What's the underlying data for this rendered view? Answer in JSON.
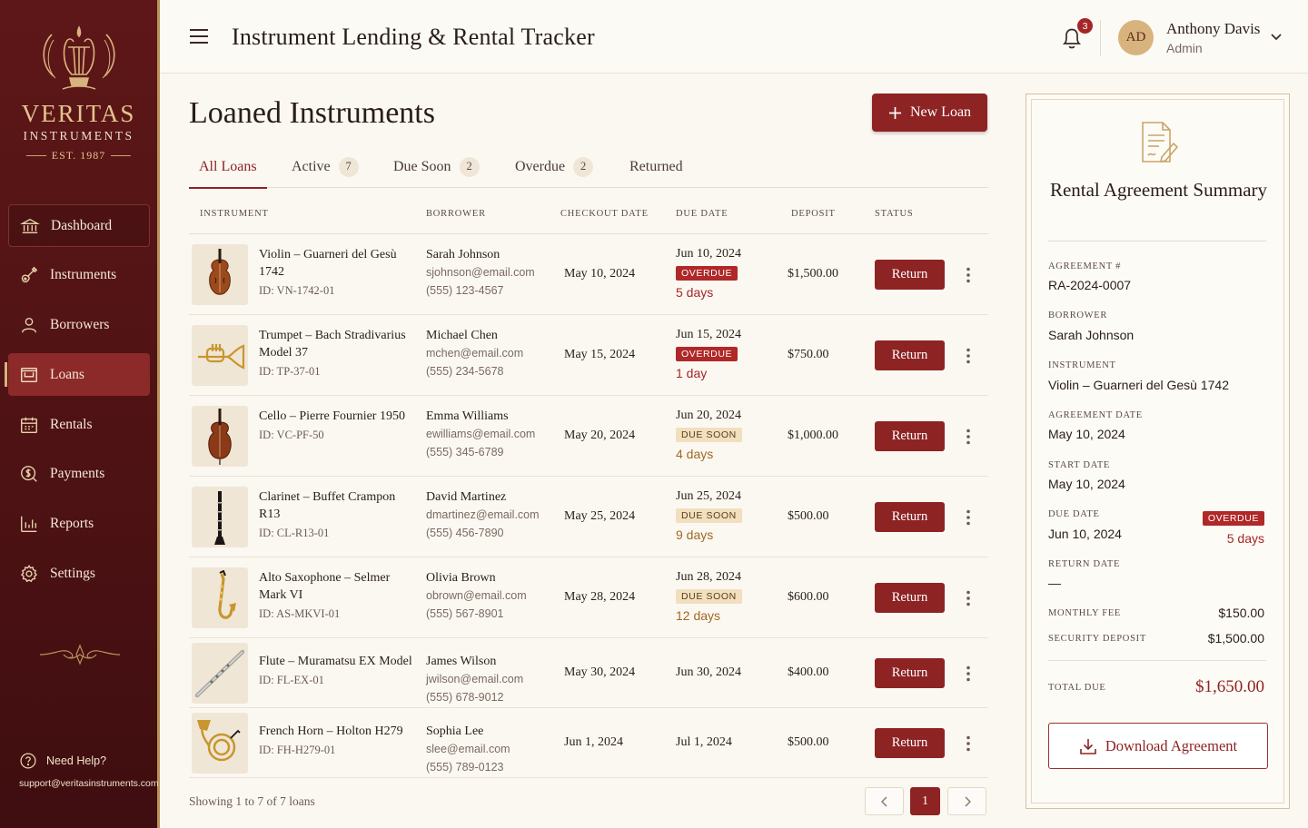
{
  "brand": {
    "name": "VERITAS",
    "sub": "INSTRUMENTS",
    "est": "EST. 1987"
  },
  "sidebar": {
    "items": [
      {
        "label": "Dashboard"
      },
      {
        "label": "Instruments"
      },
      {
        "label": "Borrowers"
      },
      {
        "label": "Loans"
      },
      {
        "label": "Rentals"
      },
      {
        "label": "Payments"
      },
      {
        "label": "Reports"
      },
      {
        "label": "Settings"
      }
    ],
    "active": "Loans",
    "help_label": "Need Help?",
    "help_email": "support@veritasinstruments.com"
  },
  "header": {
    "title": "Instrument Lending & Rental Tracker",
    "notification_count": "3",
    "user_initials": "AD",
    "user_name": "Anthony Davis",
    "user_role": "Admin"
  },
  "main": {
    "page_title": "Loaned Instruments",
    "new_loan_label": "New Loan",
    "tabs": [
      {
        "label": "All Loans",
        "count": ""
      },
      {
        "label": "Active",
        "count": "7"
      },
      {
        "label": "Due Soon",
        "count": "2"
      },
      {
        "label": "Overdue",
        "count": "2"
      },
      {
        "label": "Returned",
        "count": ""
      }
    ],
    "columns": [
      "INSTRUMENT",
      "BORROWER",
      "CHECKOUT DATE",
      "DUE DATE",
      "DEPOSIT",
      "STATUS"
    ],
    "return_label": "Return",
    "rows": [
      {
        "name": "Violin – Guarneri del Gesù 1742",
        "id": "ID: VN-1742-01",
        "borrower": "Sarah Johnson",
        "email": "sjohnson@email.com",
        "phone": "(555) 123-4567",
        "checkout": "May 10, 2024",
        "due": "Jun 10, 2024",
        "badge": "OVERDUE",
        "days": "5 days",
        "deposit": "$1,500.00"
      },
      {
        "name": "Trumpet – Bach Stradivarius Model 37",
        "id": "ID: TP-37-01",
        "borrower": "Michael Chen",
        "email": "mchen@email.com",
        "phone": "(555) 234-5678",
        "checkout": "May 15, 2024",
        "due": "Jun 15, 2024",
        "badge": "OVERDUE",
        "days": "1 day",
        "deposit": "$750.00"
      },
      {
        "name": "Cello – Pierre Fournier 1950",
        "id": "ID: VC-PF-50",
        "borrower": "Emma Williams",
        "email": "ewilliams@email.com",
        "phone": "(555) 345-6789",
        "checkout": "May 20, 2024",
        "due": "Jun 20, 2024",
        "badge": "DUE SOON",
        "days": "4 days",
        "deposit": "$1,000.00"
      },
      {
        "name": "Clarinet – Buffet Crampon R13",
        "id": "ID: CL-R13-01",
        "borrower": "David Martinez",
        "email": "dmartinez@email.com",
        "phone": "(555) 456-7890",
        "checkout": "May 25, 2024",
        "due": "Jun 25, 2024",
        "badge": "DUE SOON",
        "days": "9 days",
        "deposit": "$500.00"
      },
      {
        "name": "Alto Saxophone – Selmer Mark VI",
        "id": "ID: AS-MKVI-01",
        "borrower": "Olivia Brown",
        "email": "obrown@email.com",
        "phone": "(555) 567-8901",
        "checkout": "May 28, 2024",
        "due": "Jun 28, 2024",
        "badge": "DUE SOON",
        "days": "12 days",
        "deposit": "$600.00"
      },
      {
        "name": "Flute – Muramatsu EX Model",
        "id": "ID: FL-EX-01",
        "borrower": "James Wilson",
        "email": "jwilson@email.com",
        "phone": "(555) 678-9012",
        "checkout": "May 30, 2024",
        "due": "Jun 30, 2024",
        "badge": "",
        "days": "",
        "deposit": "$400.00"
      },
      {
        "name": "French Horn – Holton H279",
        "id": "ID: FH-H279-01",
        "borrower": "Sophia Lee",
        "email": "slee@email.com",
        "phone": "(555) 789-0123",
        "checkout": "Jun 1, 2024",
        "due": "Jul 1, 2024",
        "badge": "",
        "days": "",
        "deposit": "$500.00"
      }
    ],
    "showing": "Showing 1 to 7 of 7 loans",
    "current_page": "1"
  },
  "summary": {
    "title": "Rental Agreement Summary",
    "agreement_label": "AGREEMENT #",
    "agreement": "RA-2024-0007",
    "borrower_label": "BORROWER",
    "borrower": "Sarah Johnson",
    "instrument_label": "INSTRUMENT",
    "instrument": "Violin – Guarneri del Gesù 1742",
    "agreement_date_label": "AGREEMENT DATE",
    "agreement_date": "May 10, 2024",
    "start_date_label": "START DATE",
    "start_date": "May 10, 2024",
    "due_date_label": "DUE DATE",
    "due_date": "Jun 10, 2024",
    "due_badge": "OVERDUE",
    "due_days": "5 days",
    "return_date_label": "RETURN DATE",
    "return_date": "—",
    "monthly_fee_label": "MONTHLY FEE",
    "monthly_fee": "$150.00",
    "deposit_label": "SECURITY DEPOSIT",
    "deposit": "$1,500.00",
    "total_label": "TOTAL DUE",
    "total": "$1,650.00",
    "download_label": "Download Agreement"
  },
  "colors": {
    "accent": "#8e2323",
    "sidebar": "#5e1718",
    "gold": "#d9b37d",
    "overdue": "#b02828",
    "due_soon": "#f1dfbd"
  }
}
